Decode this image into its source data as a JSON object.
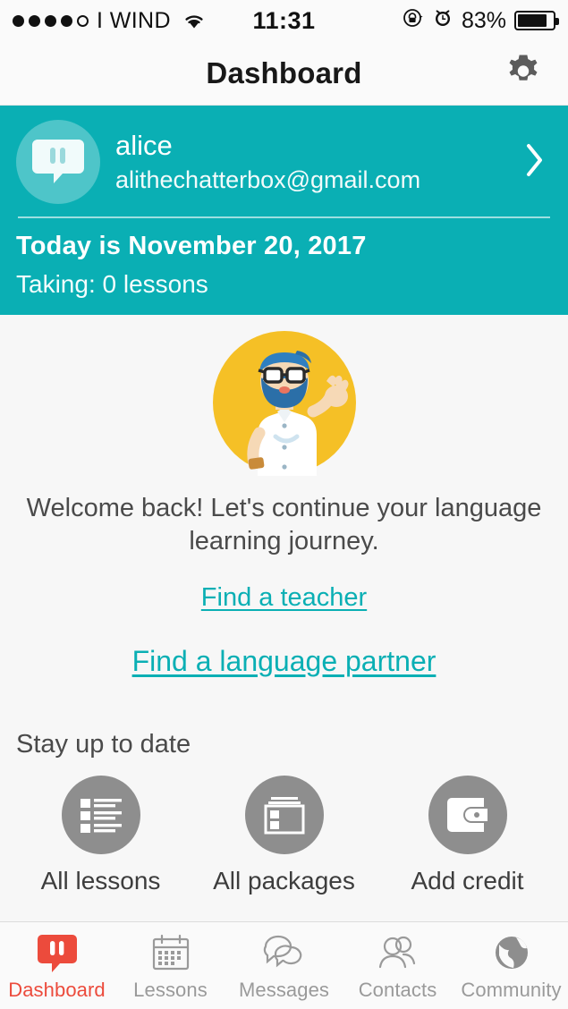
{
  "status_bar": {
    "signal_dots_filled": 4,
    "signal_dots_total": 5,
    "carrier": "I WIND",
    "wifi_icon": "wifi-icon",
    "time": "11:31",
    "rotation_lock_icon": "rotation-lock-icon",
    "alarm_icon": "alarm-clock-icon",
    "battery_percent": "83%",
    "battery_level": 83
  },
  "navbar": {
    "title": "Dashboard",
    "settings_icon": "gear-icon"
  },
  "profile": {
    "avatar_icon": "italki-speech-bubble-avatar-icon",
    "username": "alice",
    "email": "alithechatterbox@gmail.com",
    "chevron_icon": "chevron-right-icon",
    "today_line": "Today is November 20, 2017",
    "taking_line": "Taking: 0 lessons",
    "background_color": "#0aafb4"
  },
  "hero": {
    "illustration": "waving-bearded-man-illustration",
    "circle_color": "#f5c026",
    "welcome_text": "Welcome back! Let's continue your language learning journey.",
    "links": [
      {
        "label": "Find a teacher",
        "name": "find-a-teacher-link",
        "color": "#0aafb4"
      },
      {
        "label": "Find a language partner",
        "name": "find-a-language-partner-link",
        "color": "#0aafb4"
      }
    ]
  },
  "stay_up_to_date": {
    "title": "Stay up to date",
    "shortcuts": [
      {
        "label": "All lessons",
        "icon": "list-lines-icon"
      },
      {
        "label": "All packages",
        "icon": "packages-box-icon"
      },
      {
        "label": "Add credit",
        "icon": "wallet-icon"
      }
    ],
    "circle_color": "#8e8e8e"
  },
  "tabbar": {
    "active_color": "#ec4b3c",
    "inactive_color": "#9a9a9a",
    "tabs": [
      {
        "label": "Dashboard",
        "icon": "italki-speech-bubble-icon",
        "active": true
      },
      {
        "label": "Lessons",
        "icon": "calendar-icon",
        "active": false
      },
      {
        "label": "Messages",
        "icon": "chat-bubbles-icon",
        "active": false
      },
      {
        "label": "Contacts",
        "icon": "people-icon",
        "active": false
      },
      {
        "label": "Community",
        "icon": "globe-icon",
        "active": false
      }
    ]
  }
}
